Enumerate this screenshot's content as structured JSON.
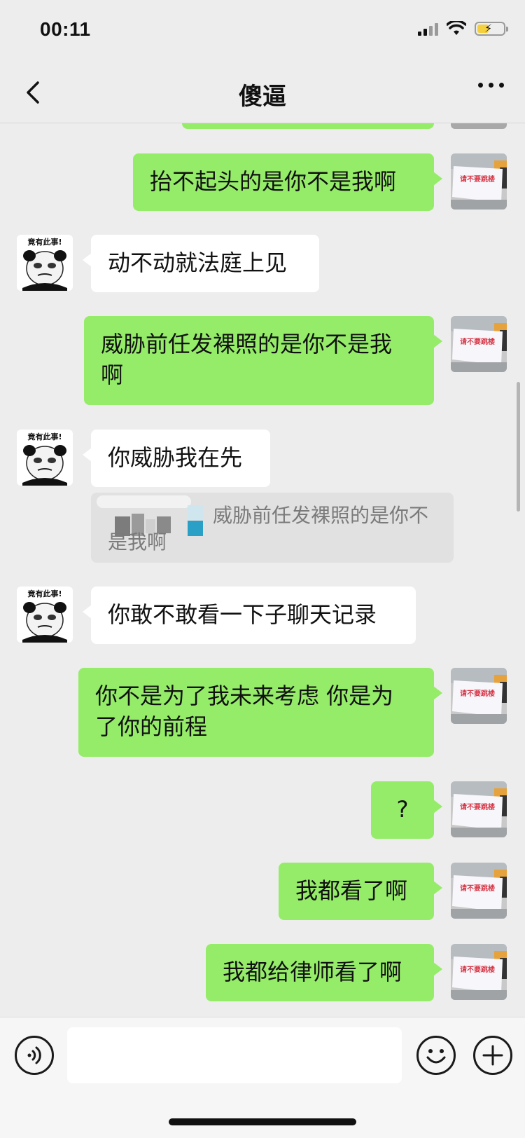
{
  "status_bar": {
    "time": "00:11",
    "battery_level": 0.45
  },
  "nav": {
    "title": "傻逼",
    "back_icon": "chevron-left-icon",
    "more_icon": "ellipsis-icon"
  },
  "messages": [
    {
      "side": "me",
      "text": "抬不起头的是你不是我啊"
    },
    {
      "side": "them",
      "text": "动不动就法庭上见",
      "avatar_caption": "竟有此事!"
    },
    {
      "side": "me",
      "text": "威胁前任发裸照的是你不是我\n啊"
    },
    {
      "side": "them",
      "text": "你威胁我在先",
      "avatar_caption": "竟有此事!",
      "quote": "威胁前任发裸照的是你不\n是我啊"
    },
    {
      "side": "them",
      "text": "你敢不敢看一下子聊天记录",
      "avatar_caption": "竟有此事!"
    },
    {
      "side": "me",
      "text": "你不是为了我未来考虑 你是为\n了你的前程"
    },
    {
      "side": "me",
      "text": "?"
    },
    {
      "side": "me",
      "text": "我都看了啊"
    },
    {
      "side": "me",
      "text": "我都给律师看了啊"
    }
  ],
  "my_avatar_caption": "请不要跳楼",
  "input": {
    "value": "",
    "voice_icon": "voice-icon",
    "emoji_icon": "emoji-icon",
    "plus_icon": "plus-icon"
  },
  "colors": {
    "my_bubble": "#95ec69",
    "their_bubble": "#ffffff",
    "background": "#ededed"
  }
}
